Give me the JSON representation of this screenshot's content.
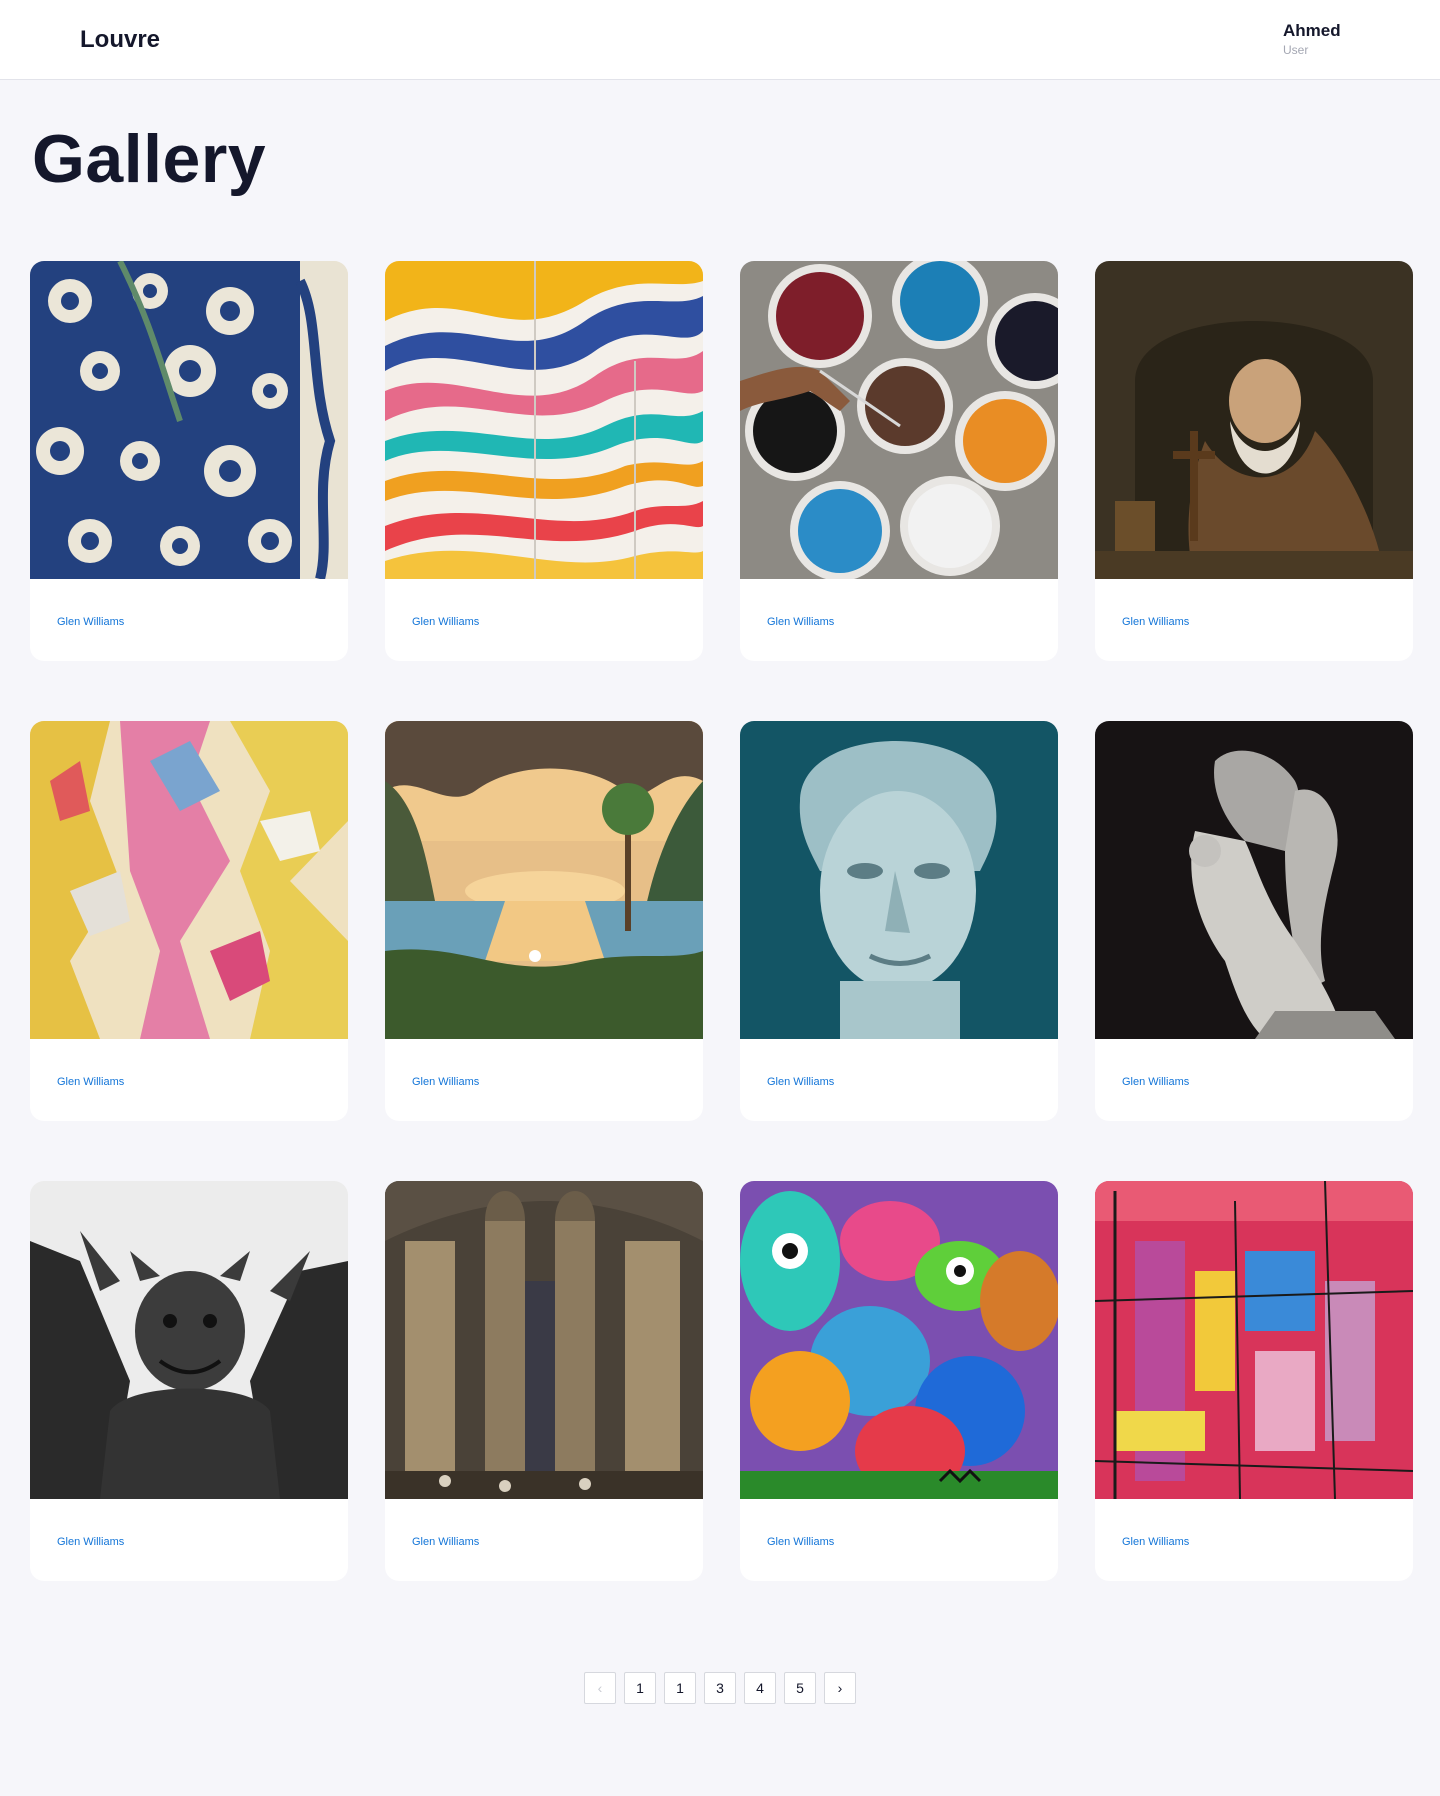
{
  "header": {
    "logo": "Louvre",
    "user_name": "Ahmed",
    "user_role": "User"
  },
  "page": {
    "title": "Gallery"
  },
  "gallery": {
    "items": [
      {
        "artist": "Glen Williams",
        "artwork": "blue-floral-pattern"
      },
      {
        "artist": "Glen Williams",
        "artwork": "colorful-wave-mural"
      },
      {
        "artist": "Glen Williams",
        "artwork": "paint-buckets"
      },
      {
        "artist": "Glen Williams",
        "artwork": "old-man-praying-painting"
      },
      {
        "artist": "Glen Williams",
        "artwork": "abstract-yellow-pink-paint"
      },
      {
        "artist": "Glen Williams",
        "artwork": "tropical-grotto-landscape"
      },
      {
        "artist": "Glen Williams",
        "artwork": "teal-statue-head"
      },
      {
        "artist": "Glen Williams",
        "artwork": "marble-sculpture-dark"
      },
      {
        "artist": "Glen Williams",
        "artwork": "gargoyle-statue"
      },
      {
        "artist": "Glen Williams",
        "artwork": "gothic-cathedral-interior"
      },
      {
        "artist": "Glen Williams",
        "artwork": "graffiti-monsters"
      },
      {
        "artist": "Glen Williams",
        "artwork": "abstract-red-brushstrokes"
      }
    ]
  },
  "pagination": {
    "prev_icon": "chevron-left-icon",
    "next_icon": "chevron-right-icon",
    "prev_glyph": "‹",
    "next_glyph": "›",
    "pages": [
      "1",
      "1",
      "3",
      "4",
      "5"
    ]
  }
}
